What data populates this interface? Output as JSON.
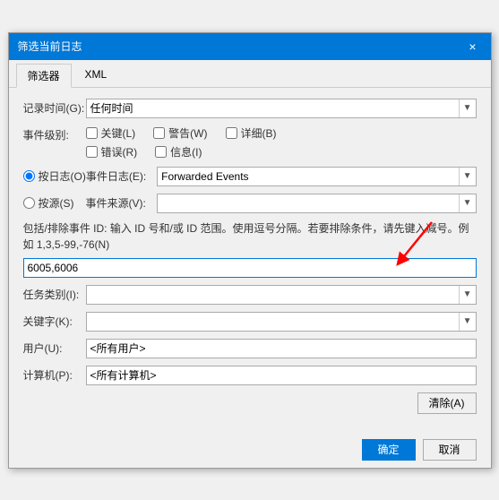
{
  "dialog": {
    "title": "筛选当前日志",
    "close_label": "×",
    "tabs": [
      {
        "id": "filter",
        "label": "筛选器"
      },
      {
        "id": "xml",
        "label": "XML"
      }
    ],
    "active_tab": "filter"
  },
  "filter": {
    "record_time_label": "记录时间(G):",
    "record_time_value": "任何时间",
    "event_level_label": "事件级别:",
    "checkboxes": [
      {
        "id": "critical",
        "label": "关键(L)",
        "checked": false
      },
      {
        "id": "warning",
        "label": "警告(W)",
        "checked": false
      },
      {
        "id": "detailed",
        "label": "详细(B)",
        "checked": false
      },
      {
        "id": "error",
        "label": "错误(R)",
        "checked": false
      },
      {
        "id": "info",
        "label": "信息(I)",
        "checked": false
      }
    ],
    "by_log_label": "按日志(O)",
    "by_source_label": "按源(S)",
    "event_log_label": "事件日志(E):",
    "event_log_value": "Forwarded Events",
    "event_source_label": "事件来源(V):",
    "event_source_value": "",
    "description": "包括/排除事件 ID: 输入 ID 号和/或 ID 范围。使用逗号分隔。若要排除条件，请先键入减号。例如 1,3,5-99,-76(N)",
    "event_id_value": "6005,6006",
    "task_category_label": "任务类别(I):",
    "task_category_value": "",
    "keyword_label": "关键字(K):",
    "keyword_value": "",
    "user_label": "用户(U):",
    "user_value": "<所有用户>",
    "computer_label": "计算机(P):",
    "computer_value": "<所有计算机>",
    "clear_label": "清除(A)",
    "ok_label": "确定",
    "cancel_label": "取消"
  }
}
